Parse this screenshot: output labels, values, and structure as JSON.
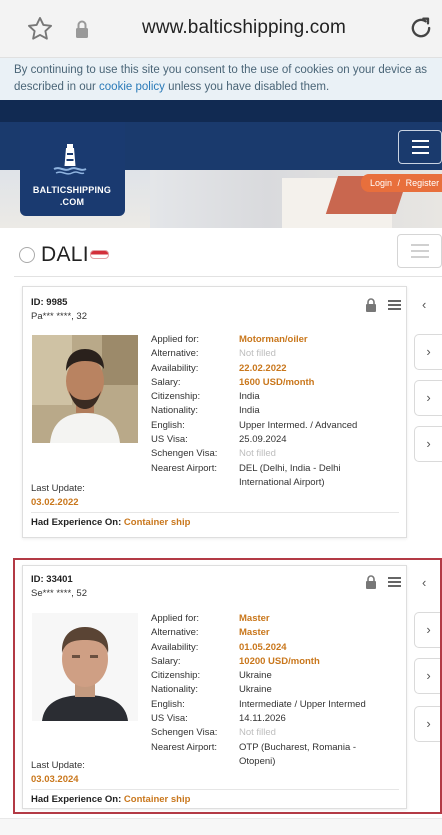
{
  "browser": {
    "url": "www.balticshipping.com",
    "icons": [
      "star-icon",
      "lock-icon",
      "reload-icon"
    ]
  },
  "cookie_banner": {
    "text_before": "By continuing to use this site you consent to the use of cookies on your device as described in our ",
    "link": "cookie policy",
    "text_after": " unless you have disabled them."
  },
  "header": {
    "logo_line1": "BALTICSHIPPING",
    "logo_line2": ".COM",
    "login": "Login",
    "separator": "/",
    "register": "Register",
    "colors": {
      "navy": "#1a3a70",
      "orange": "#e86f3c"
    }
  },
  "vessel": {
    "name": "DALI"
  },
  "labels": {
    "applied_for": "Applied for:",
    "alternative": "Alternative:",
    "availability": "Availability:",
    "salary": "Salary:",
    "citizenship": "Citizenship:",
    "nationality": "Nationality:",
    "english": "English:",
    "us_visa": "US Visa:",
    "schengen_visa": "Schengen Visa:",
    "nearest_airport": "Nearest Airport:",
    "last_update": "Last Update:",
    "had_experience": "Had Experience On:"
  },
  "cards": [
    {
      "id": "ID: 9985",
      "name": "Pa*** ****, 32",
      "applied_for": "Motorman/oiler",
      "alternative": "Not filled",
      "availability": "22.02.2022",
      "salary": "1600 USD/month",
      "citizenship": "India",
      "nationality": "India",
      "english": "Upper Intermed. / Advanced",
      "us_visa": "25.09.2024",
      "schengen_visa": "Not filled",
      "airport_line1": "DEL (Delhi, India - Delhi",
      "airport_line2": "International Airport)",
      "last_update": "03.02.2022",
      "experience": "Container ship"
    },
    {
      "id": "ID: 33401",
      "name": "Se*** ****, 52",
      "applied_for": "Master",
      "alternative": "Master",
      "availability": "01.05.2024",
      "salary": "10200 USD/month",
      "citizenship": "Ukraine",
      "nationality": "Ukraine",
      "english": "Intermediate / Upper Intermed",
      "us_visa": "14.11.2026",
      "schengen_visa": "Not filled",
      "airport_line1": "OTP (Bucharest, Romania -",
      "airport_line2": "Otopeni)",
      "last_update": "03.03.2024",
      "experience": "Container ship"
    }
  ],
  "side_tabs": [
    "‹",
    "›",
    "›",
    "›",
    "‹",
    "›",
    "›",
    "›"
  ]
}
